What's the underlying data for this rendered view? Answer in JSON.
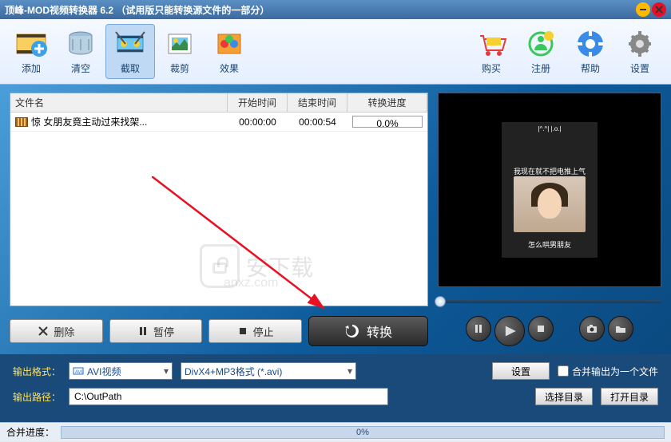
{
  "title": "顶峰-MOD视频转换器  6.2 （试用版只能转换源文件的一部分）",
  "toolbar": {
    "add": "添加",
    "clear": "清空",
    "cut": "截取",
    "crop": "裁剪",
    "effect": "效果",
    "buy": "购买",
    "register": "注册",
    "help": "帮助",
    "settings": "设置"
  },
  "list": {
    "headers": {
      "name": "文件名",
      "start": "开始时间",
      "end": "结束时间",
      "progress": "转换进度"
    },
    "rows": [
      {
        "name": "惊 女朋友竟主动过来找架...",
        "start": "00:00:00",
        "end": "00:00:54",
        "progress": "0.0%"
      }
    ]
  },
  "actions": {
    "delete": "删除",
    "pause": "暂停",
    "stop": "停止",
    "convert": "转换"
  },
  "preview": {
    "top_text": "|^.^| |.o.|",
    "mid_text": "我现在就不把电推上气",
    "bottom_text": "怎么哄男朋友"
  },
  "output": {
    "format_label": "输出格式：",
    "format_dd1": "AVI视频",
    "format_dd2": "DivX4+MP3格式 (*.avi)",
    "settings_btn": "设置",
    "merge_checkbox": "合并输出为一个文件",
    "path_label": "输出路径：",
    "path_value": "C:\\OutPath",
    "choose_dir": "选择目录",
    "open_dir": "打开目录"
  },
  "bottom": {
    "label": "合并进度：",
    "percent": "0%"
  },
  "watermark": {
    "text": "安下载",
    "sub": "anxz.com"
  }
}
